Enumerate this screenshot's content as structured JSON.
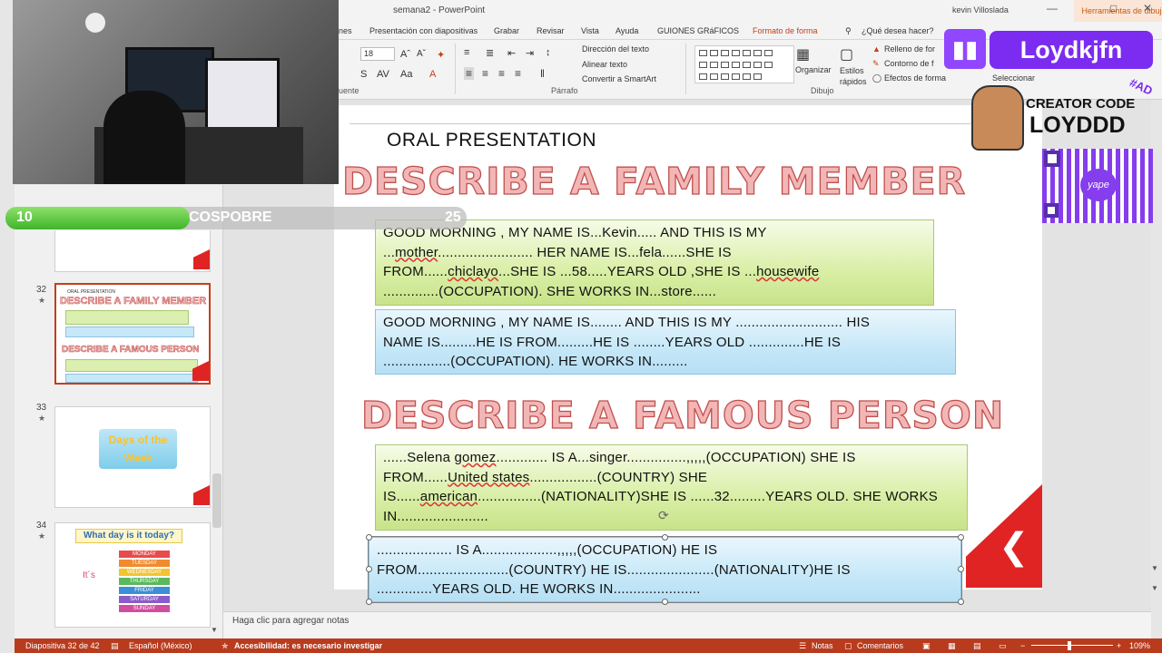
{
  "titlebar": {
    "title": "semana2  -  PowerPoint",
    "context_tab": "Herramientas de dibujo",
    "user": "kevin Villoslada"
  },
  "ribbon_tabs": [
    {
      "label": "nes"
    },
    {
      "label": "Presentación con diapositivas"
    },
    {
      "label": "Grabar"
    },
    {
      "label": "Revisar"
    },
    {
      "label": "Vista"
    },
    {
      "label": "Ayuda"
    },
    {
      "label": "GUIONES GRáFICOS"
    },
    {
      "label": "Formato de forma"
    },
    {
      "label": "¿Qué desea hacer?"
    }
  ],
  "ribbon": {
    "font_size": "18",
    "group_font": "uente",
    "group_paragraph": "Párrafo",
    "group_drawing": "Dibujo",
    "text_direction": "Dirección del texto",
    "align_text": "Alinear texto",
    "convert_smartart": "Convertir a SmartArt",
    "organize": "Organizar",
    "styles": "Estilos rápidos",
    "fill": "Relleno de for",
    "outline": "Contorno de f",
    "effects": "Efectos de forma",
    "select": "Seleccionar"
  },
  "slide": {
    "oral": "ORAL PRESENTATION",
    "title1": "DESCRIBE A FAMILY MEMBER",
    "title2": "DESCRIBE A FAMOUS PERSON",
    "box1": {
      "l1": "GOOD MORNING , MY NAME IS...Kevin..... AND THIS IS  MY",
      "l2a": "...",
      "l2b": "mother",
      "l2c": "........................ HER NAME IS...fela......SHE IS",
      "l3a": "FROM......",
      "l3b": "chiclayo",
      "l3c": "...SHE IS ...58.....YEARS OLD ,SHE IS ...",
      "l3d": "housewife",
      "l4": "..............(OCCUPATION). SHE WORKS IN...store......"
    },
    "box2": {
      "l1": "GOOD MORNING , MY NAME IS........ AND THIS IS  MY ........................... HIS",
      "l2": "NAME IS.........HE IS  FROM.........HE IS ........YEARS OLD ..............HE IS",
      "l3": ".................(OCCUPATION). HE WORKS IN........."
    },
    "box3": {
      "l1a": "......Selena ",
      "l1b": "gomez",
      "l1c": ".............  IS A...singer...............,,,,,(OCCUPATION) SHE IS",
      "l2a": "FROM......",
      "l2b": "United states",
      "l2c": ".................(COUNTRY) SHE",
      "l3a": "IS......",
      "l3b": "american",
      "l3c": "................(NATIONALITY)SHE IS ......32.........YEARS OLD. SHE WORKS",
      "l4": "IN......................."
    },
    "box4": {
      "l1": "...................  IS A...................,,,,,(OCCUPATION) HE IS",
      "l2": "FROM.......................(COUNTRY) HE IS......................(NATIONALITY)HE IS",
      "l3": "..............YEARS OLD.  HE WORKS IN......................"
    }
  },
  "notes_placeholder": "Haga clic para agregar notas",
  "thumbnails": [
    {
      "num": "32",
      "title1": "DESCRIBE A FAMILY MEMBER",
      "title2": "DESCRIBE A FAMOUS PERSON",
      "heading": "ORAL PRESENTATION"
    },
    {
      "num": "33",
      "title": "Days of the Week"
    },
    {
      "num": "34",
      "title": "What day is it today?",
      "side": "It´s",
      "days": [
        "MONDAY",
        "TUESDAY",
        "WEDNESDAY",
        "THURSDAY",
        "FRIDAY",
        "SATURDAY",
        "SUNDAY"
      ]
    }
  ],
  "status": {
    "slide_info": "Diapositiva 32 de 42",
    "language": "Español (México)",
    "accessibility": "Accesibilidad: es necesario investigar",
    "notes": "Notas",
    "comments": "Comentarios",
    "zoom": "109%"
  },
  "overlay": {
    "progress_num": "10",
    "progress_label": "COSPOBRE",
    "progress_goal": "25",
    "progress_fraction": 0.4,
    "twitch_name": "Loydkjfn",
    "creator_line1": "CREATOR CODE",
    "creator_line2": "LOYDDD",
    "creator_tag": "#AD",
    "qr_label": "yape"
  },
  "colors": {
    "accent": "#c43e1c",
    "status_bar": "#b83b1e",
    "twitch": "#7b2cf0",
    "title_fill": "#f2b6b6",
    "title_stroke": "#c0504d"
  }
}
